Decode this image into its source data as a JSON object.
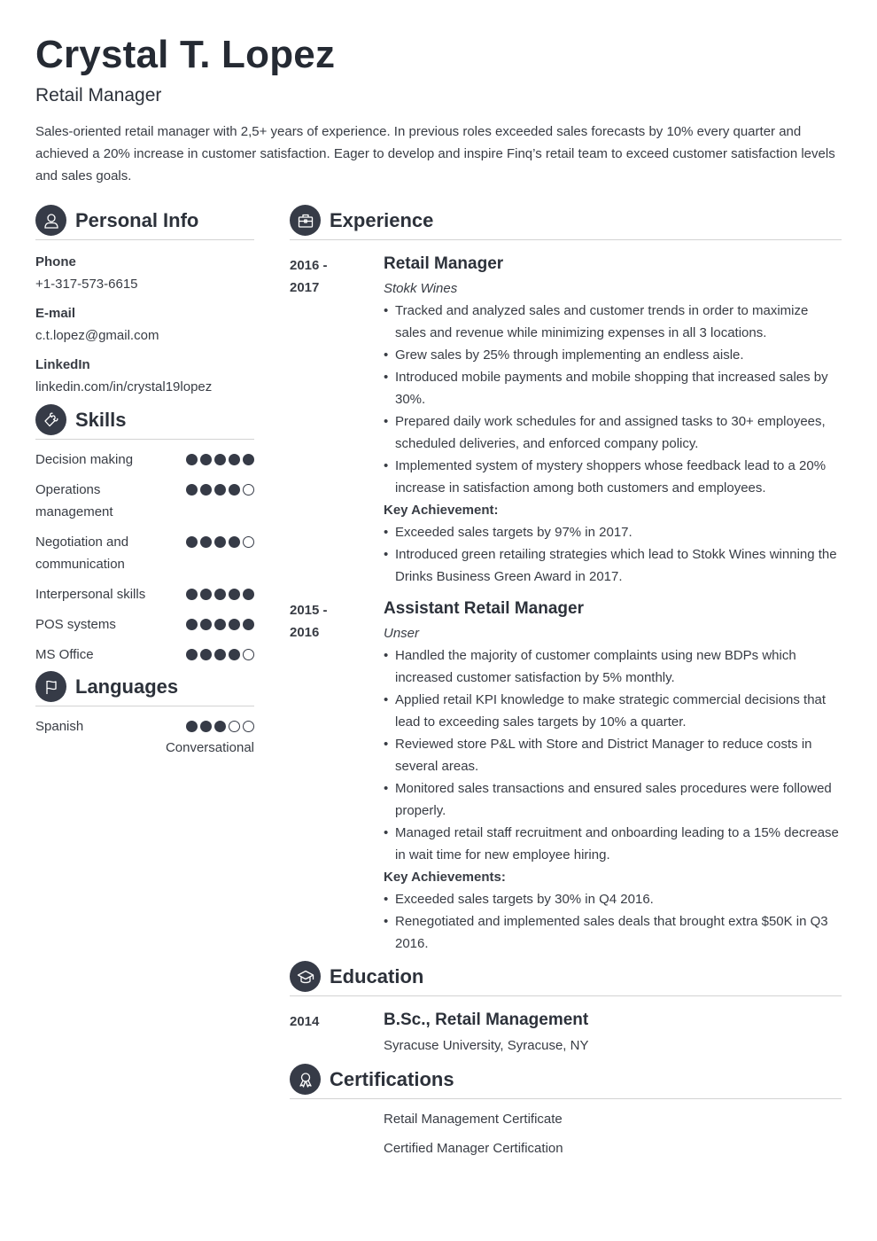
{
  "header": {
    "name": "Crystal T. Lopez",
    "title": "Retail Manager",
    "summary": "Sales-oriented retail manager with 2,5+ years of experience. In previous roles exceeded sales forecasts by 10% every quarter and achieved a 20% increase in customer satisfaction. Eager to develop and inspire Finq’s retail team to exceed customer satisfaction levels and sales goals."
  },
  "personal_info": {
    "title": "Personal Info",
    "icon": "user-icon",
    "items": [
      {
        "label": "Phone",
        "value": "+1-317-573-6615"
      },
      {
        "label": "E-mail",
        "value": "c.t.lopez@gmail.com"
      },
      {
        "label": "LinkedIn",
        "value": "linkedin.com/in/crystal19lopez"
      }
    ]
  },
  "skills": {
    "title": "Skills",
    "icon": "puzzle-icon",
    "max_rating": 5,
    "items": [
      {
        "name": "Decision making",
        "rating": 5
      },
      {
        "name": "Operations management",
        "rating": 4
      },
      {
        "name": "Negotiation and communication",
        "rating": 4
      },
      {
        "name": "Interpersonal skills",
        "rating": 5
      },
      {
        "name": "POS systems",
        "rating": 5
      },
      {
        "name": "MS Office",
        "rating": 4
      }
    ]
  },
  "languages": {
    "title": "Languages",
    "icon": "flag-icon",
    "items": [
      {
        "name": "Spanish",
        "rating": 3,
        "level": "Conversational"
      }
    ]
  },
  "experience": {
    "title": "Experience",
    "icon": "briefcase-icon",
    "items": [
      {
        "date_start": "2016 -",
        "date_end": "2017",
        "title": "Retail Manager",
        "company": "Stokk Wines",
        "bullets": [
          "Tracked and analyzed sales and customer trends in order to maximize sales and revenue while minimizing expenses in all 3 locations.",
          "Grew sales by 25% through implementing an endless aisle.",
          "Introduced mobile payments and mobile shopping that increased sales by 30%.",
          "Prepared daily work schedules for and assigned tasks to 30+ employees, scheduled deliveries, and enforced company policy.",
          "Implemented system of mystery shoppers whose feedback lead to a 20% increase in satisfaction among both customers and employees."
        ],
        "key_label": "Key Achievement:",
        "key_bullets": [
          "Exceeded sales targets by 97% in 2017.",
          "Introduced green retailing strategies which lead to Stokk Wines winning the Drinks Business Green Award in 2017."
        ]
      },
      {
        "date_start": "2015 -",
        "date_end": "2016",
        "title": "Assistant Retail Manager",
        "company": "Unser",
        "bullets": [
          "Handled the majority of customer complaints using new BDPs which increased customer satisfaction by 5% monthly.",
          "Applied retail KPI knowledge to make strategic commercial decisions that lead to exceeding sales targets by 10% a quarter.",
          "Reviewed store P&L with Store and District Manager to reduce costs in several areas.",
          "Monitored sales transactions and ensured sales procedures were followed properly.",
          "Managed retail staff recruitment and onboarding leading to a 15% decrease in wait time for new employee hiring."
        ],
        "key_label": "Key Achievements:",
        "key_bullets": [
          "Exceeded sales targets by 30% in Q4 2016.",
          "Renegotiated and implemented sales deals that brought extra $50K in Q3 2016."
        ]
      }
    ]
  },
  "education": {
    "title": "Education",
    "icon": "graduation-cap-icon",
    "items": [
      {
        "date": "2014",
        "degree": "B.Sc., Retail Management",
        "school": "Syracuse University, Syracuse, NY"
      }
    ]
  },
  "certifications": {
    "title": "Certifications",
    "icon": "award-ribbon-icon",
    "items": [
      "Retail Management Certificate",
      "Certified Manager Certification"
    ]
  }
}
